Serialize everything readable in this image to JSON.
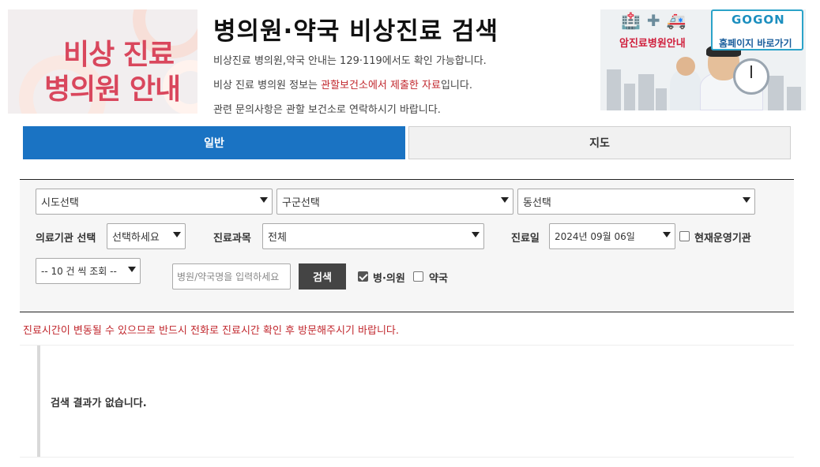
{
  "header": {
    "logo_line1": "비상 진료",
    "logo_line2": "병의원 안내",
    "title": "병의원·약국 비상진료 검색",
    "info1": "비상진료 병의원,약국 안내는 129·119에서도 확인 가능합니다.",
    "info2_pre": "비상 진료 병의원 정보는 ",
    "info2_red": "관할보건소에서 제출한 자료",
    "info2_post": "입니다.",
    "info3": "관련 문의사항은 관할 보건소로 연락하시기 바랍니다."
  },
  "banner": {
    "label1": "암진료병원안내",
    "logo": "GOGON",
    "label2": "홈페이지 바로가기",
    "icons": [
      "hospital-building-icon",
      "pharmacy-icon",
      "ambulance-icon"
    ]
  },
  "tabs": [
    {
      "label": "일반",
      "active": true
    },
    {
      "label": "지도",
      "active": false
    }
  ],
  "filters": {
    "sido": "시도선택",
    "gugun": "구군선택",
    "dong": "동선택",
    "org_label": "의료기관 선택",
    "org_value": "선택하세요",
    "dept_label": "진료과목",
    "dept_value": "전체",
    "date_label": "진료일",
    "date_value": "2024년 09월 06일",
    "open_now_label": "현재운영기관",
    "open_now_checked": false,
    "page_size": "-- 10 건 씩 조회 --",
    "name_placeholder": "병원/약국명을 입력하세요",
    "search_label": "검색",
    "hospital_label": "병·의원",
    "hospital_checked": true,
    "pharmacy_label": "약국",
    "pharmacy_checked": false
  },
  "notice": "진료시간이 변동될 수 있으므로 반드시 전화로 진료시간 확인 후 방문해주시기 바랍니다.",
  "result": {
    "empty_message": "검색 결과가 없습니다."
  },
  "colors": {
    "accent": "#1a73c3",
    "notice_red": "#c1272d",
    "logo_pink": "#d9475d"
  }
}
